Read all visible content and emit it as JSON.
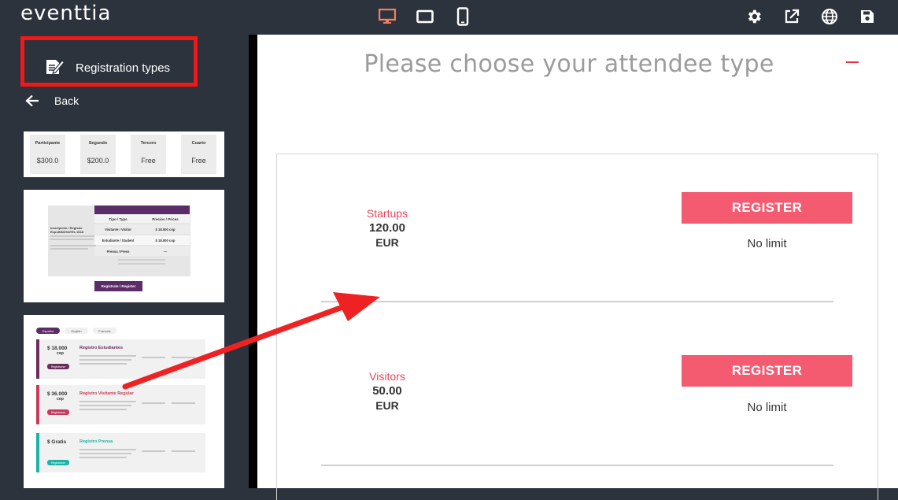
{
  "app": {
    "logo_text": "eventtia"
  },
  "toolbar": {
    "devices": [
      "desktop-icon",
      "tablet-icon",
      "mobile-icon"
    ],
    "tools": [
      "gear-icon",
      "external-link-icon",
      "globe-icon",
      "save-icon"
    ],
    "active_device_color": "#f07f63"
  },
  "sidebar": {
    "section_title": "Registration types",
    "back_label": "Back",
    "thumbnails": {
      "t1": {
        "columns": [
          {
            "label": "Participante",
            "price": "$300.0"
          },
          {
            "label": "Segundo",
            "price": "$200.0"
          },
          {
            "label": "Tercero",
            "price": "Free"
          },
          {
            "label": "Cuarto",
            "price": "Free"
          }
        ]
      },
      "t2": {
        "col1": "Tipo / Type",
        "col2": "Precios / Prices",
        "rows": [
          {
            "type": "Visitante / Visitor",
            "price": "$ 18.000 cop"
          },
          {
            "type": "Estudiante / Student",
            "price": "$ 18.000 cop"
          },
          {
            "type": "Prensa / Press",
            "price": "—"
          }
        ],
        "left_title": "Inscripción / Register ExpoINNOVATEL 2018",
        "button": "Regístrate / Register"
      },
      "t3": {
        "tabs": [
          "Español",
          "English",
          "Francais"
        ],
        "items": [
          {
            "price": "$ 18.000",
            "unit": "cop",
            "title": "Registro Estudiantes",
            "button": "Registrarse",
            "color": "#6b2d5c"
          },
          {
            "price": "$ 36.000",
            "unit": "cop",
            "title": "Registro Visitante Regular",
            "button": "Registrarse",
            "color": "#c83a5a"
          },
          {
            "price": "$ Gratis",
            "unit": "",
            "title": "Registro Prensa",
            "button": "Registrarse",
            "color": "#1bb3a4"
          }
        ]
      }
    }
  },
  "main": {
    "heading": "Please choose your attendee type",
    "types": [
      {
        "name": "Startups",
        "price": "120.00",
        "currency": "EUR",
        "button": "REGISTER",
        "limit": "No limit"
      },
      {
        "name": "Visitors",
        "price": "50.00",
        "currency": "EUR",
        "button": "REGISTER",
        "limit": "No limit"
      }
    ]
  },
  "colors": {
    "sidebar_bg": "#2d333d",
    "accent_red": "#f45a70",
    "highlight_box": "#f01818",
    "annotation_arrow": "#ee2222"
  }
}
